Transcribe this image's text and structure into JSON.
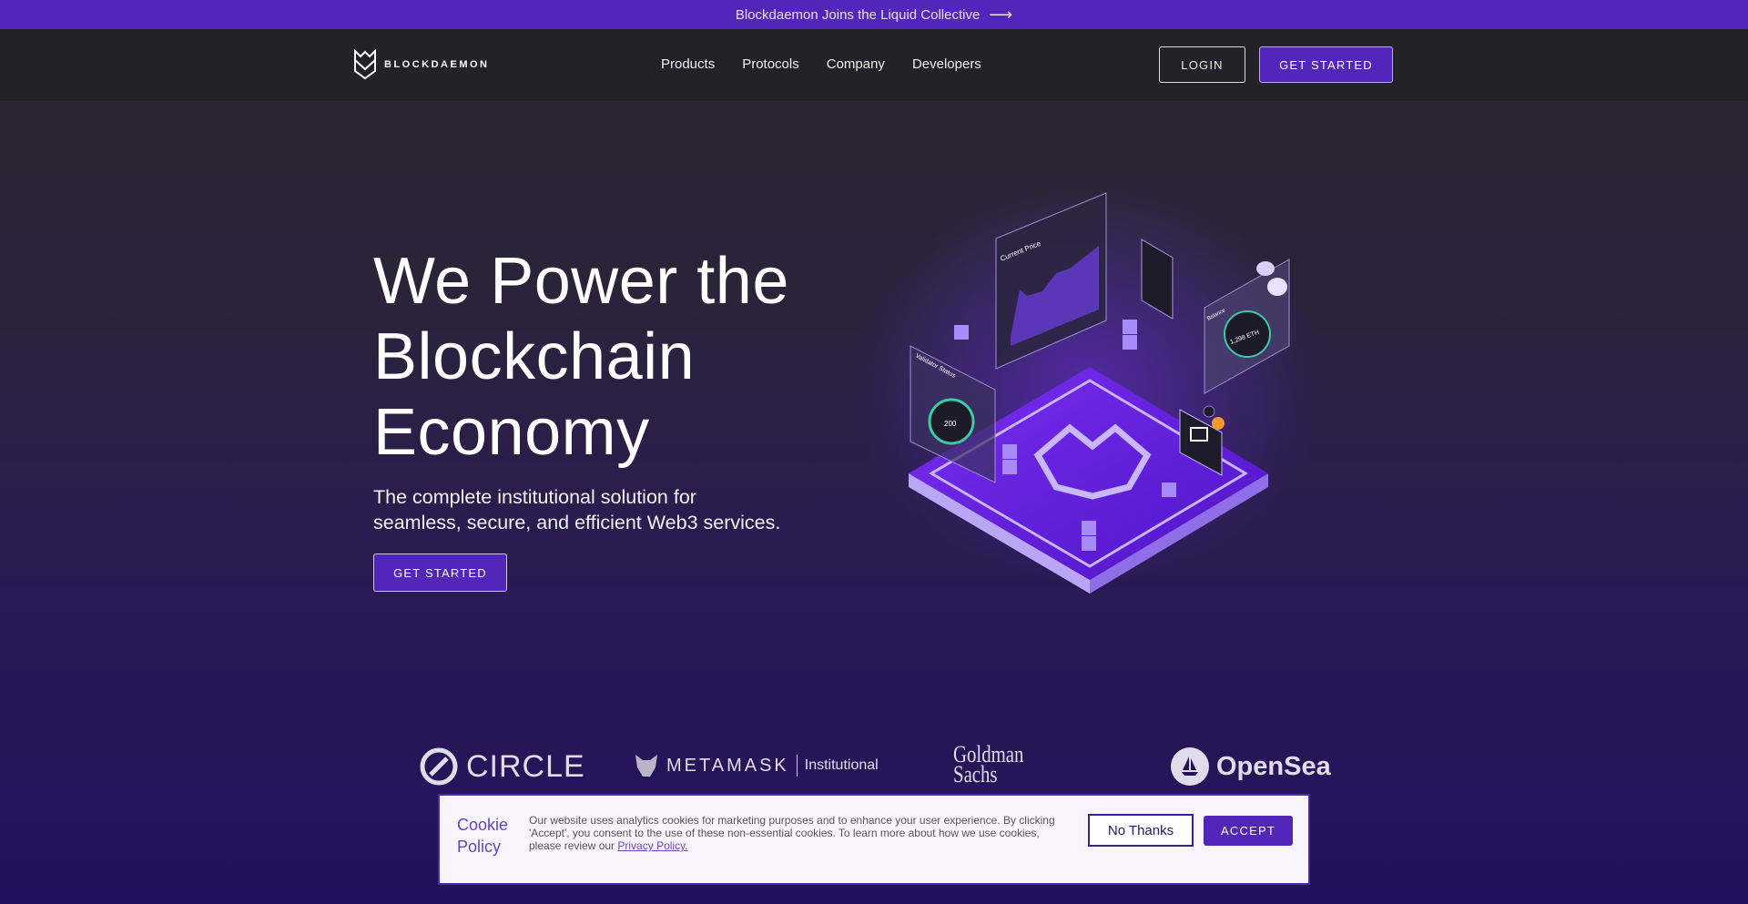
{
  "banner": {
    "text": "Blockdaemon Joins the Liquid Collective",
    "arrow_icon": "arrow-right-icon"
  },
  "nav": {
    "logo_text": "BLOCKDAEMON",
    "items": [
      {
        "label": "Products"
      },
      {
        "label": "Protocols"
      },
      {
        "label": "Company"
      },
      {
        "label": "Developers"
      }
    ],
    "login": "LOGIN",
    "get_started": "GET STARTED"
  },
  "hero": {
    "title_lines": [
      "We Power the",
      "Blockchain",
      "Economy"
    ],
    "subtitle_lines": [
      "The complete institutional solution for",
      "seamless, secure, and efficient Web3 services."
    ],
    "cta": "GET STARTED",
    "illustration": {
      "price_panel": "Current Price",
      "validator_panel": "Validator Status",
      "validator_value": "200",
      "balance_panel": "Balance",
      "balance_value": "1,298 ETH"
    }
  },
  "partners": [
    {
      "name": "CIRCLE"
    },
    {
      "name": "METAMASK",
      "suffix": "Institutional"
    },
    {
      "name_lines": [
        "Goldman",
        "Sachs"
      ]
    },
    {
      "name": "OpenSea"
    }
  ],
  "cookie": {
    "title": "Cookie Policy",
    "text": "Our website uses analytics cookies for marketing purposes and to enhance your user experience. By clicking 'Accept', you consent to the use of these non-essential cookies. To learn more about how we use cookies, please review our ",
    "link": "Privacy Policy.",
    "no_thanks": "No Thanks",
    "accept": "ACCEPT"
  },
  "colors": {
    "brand": "#5126b9",
    "nav_bg": "#232228",
    "cookie_bg": "#f9f5ff"
  }
}
